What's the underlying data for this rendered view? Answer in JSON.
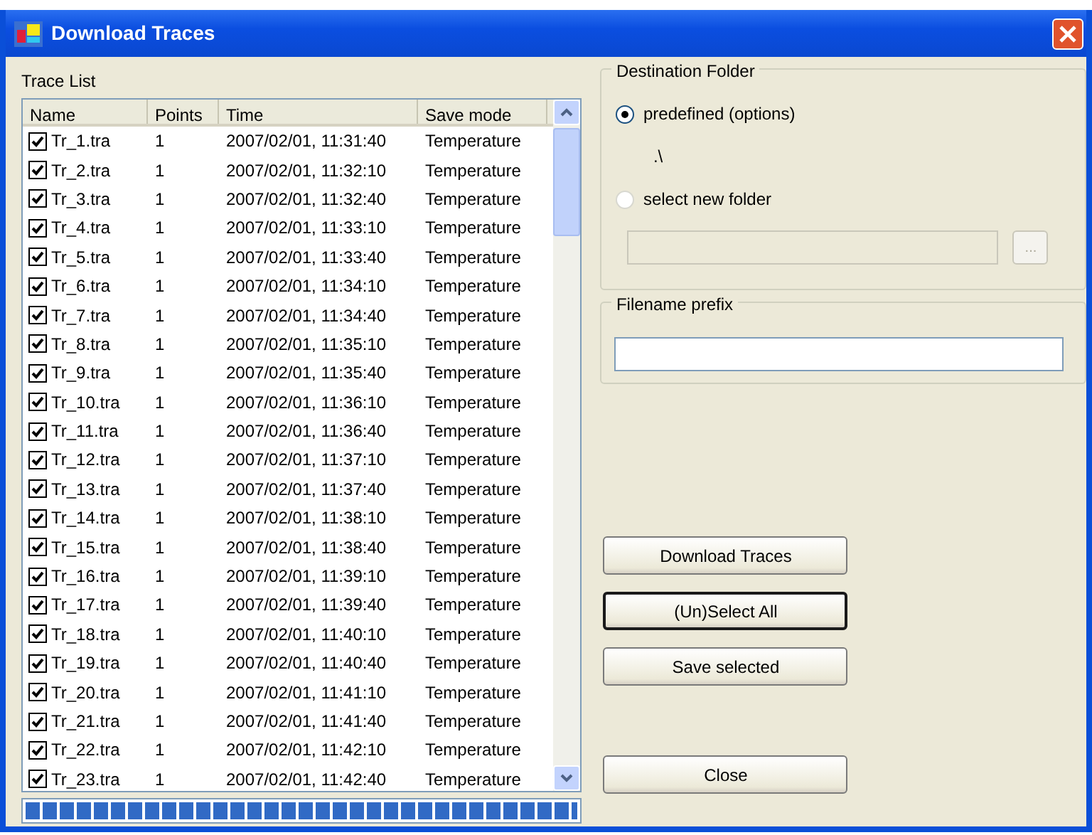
{
  "window": {
    "title": "Download Traces"
  },
  "trace_list": {
    "label": "Trace List",
    "columns": [
      "Name",
      "Points",
      "Time",
      "Save mode"
    ],
    "rows": [
      {
        "name": "Tr_1.tra",
        "points": "1",
        "time": "2007/02/01, 11:31:40",
        "save_mode": "Temperature",
        "checked": true
      },
      {
        "name": "Tr_2.tra",
        "points": "1",
        "time": "2007/02/01, 11:32:10",
        "save_mode": "Temperature",
        "checked": true
      },
      {
        "name": "Tr_3.tra",
        "points": "1",
        "time": "2007/02/01, 11:32:40",
        "save_mode": "Temperature",
        "checked": true
      },
      {
        "name": "Tr_4.tra",
        "points": "1",
        "time": "2007/02/01, 11:33:10",
        "save_mode": "Temperature",
        "checked": true
      },
      {
        "name": "Tr_5.tra",
        "points": "1",
        "time": "2007/02/01, 11:33:40",
        "save_mode": "Temperature",
        "checked": true
      },
      {
        "name": "Tr_6.tra",
        "points": "1",
        "time": "2007/02/01, 11:34:10",
        "save_mode": "Temperature",
        "checked": true
      },
      {
        "name": "Tr_7.tra",
        "points": "1",
        "time": "2007/02/01, 11:34:40",
        "save_mode": "Temperature",
        "checked": true
      },
      {
        "name": "Tr_8.tra",
        "points": "1",
        "time": "2007/02/01, 11:35:10",
        "save_mode": "Temperature",
        "checked": true
      },
      {
        "name": "Tr_9.tra",
        "points": "1",
        "time": "2007/02/01, 11:35:40",
        "save_mode": "Temperature",
        "checked": true
      },
      {
        "name": "Tr_10.tra",
        "points": "1",
        "time": "2007/02/01, 11:36:10",
        "save_mode": "Temperature",
        "checked": true
      },
      {
        "name": "Tr_11.tra",
        "points": "1",
        "time": "2007/02/01, 11:36:40",
        "save_mode": "Temperature",
        "checked": true
      },
      {
        "name": "Tr_12.tra",
        "points": "1",
        "time": "2007/02/01, 11:37:10",
        "save_mode": "Temperature",
        "checked": true
      },
      {
        "name": "Tr_13.tra",
        "points": "1",
        "time": "2007/02/01, 11:37:40",
        "save_mode": "Temperature",
        "checked": true
      },
      {
        "name": "Tr_14.tra",
        "points": "1",
        "time": "2007/02/01, 11:38:10",
        "save_mode": "Temperature",
        "checked": true
      },
      {
        "name": "Tr_15.tra",
        "points": "1",
        "time": "2007/02/01, 11:38:40",
        "save_mode": "Temperature",
        "checked": true
      },
      {
        "name": "Tr_16.tra",
        "points": "1",
        "time": "2007/02/01, 11:39:10",
        "save_mode": "Temperature",
        "checked": true
      },
      {
        "name": "Tr_17.tra",
        "points": "1",
        "time": "2007/02/01, 11:39:40",
        "save_mode": "Temperature",
        "checked": true
      },
      {
        "name": "Tr_18.tra",
        "points": "1",
        "time": "2007/02/01, 11:40:10",
        "save_mode": "Temperature",
        "checked": true
      },
      {
        "name": "Tr_19.tra",
        "points": "1",
        "time": "2007/02/01, 11:40:40",
        "save_mode": "Temperature",
        "checked": true
      },
      {
        "name": "Tr_20.tra",
        "points": "1",
        "time": "2007/02/01, 11:41:10",
        "save_mode": "Temperature",
        "checked": true
      },
      {
        "name": "Tr_21.tra",
        "points": "1",
        "time": "2007/02/01, 11:41:40",
        "save_mode": "Temperature",
        "checked": true
      },
      {
        "name": "Tr_22.tra",
        "points": "1",
        "time": "2007/02/01, 11:42:10",
        "save_mode": "Temperature",
        "checked": true
      },
      {
        "name": "Tr_23.tra",
        "points": "1",
        "time": "2007/02/01, 11:42:40",
        "save_mode": "Temperature",
        "checked": true
      }
    ]
  },
  "progress": {
    "level": 1
  },
  "destination_folder": {
    "label": "Destination Folder",
    "options": [
      {
        "label": "predefined (options)",
        "selected": true
      },
      {
        "label": "select new folder",
        "selected": false
      }
    ],
    "predefined_path": ".\\",
    "browse_button": "...",
    "folder_field_disabled": true
  },
  "filename_prefix": {
    "label": "Filename prefix"
  },
  "buttons": [
    {
      "label": "Download Traces",
      "default": false
    },
    {
      "label": "(Un)Select All",
      "default": true
    },
    {
      "label": "Save selected",
      "default": false
    },
    {
      "label": "Close",
      "default": false
    }
  ]
}
